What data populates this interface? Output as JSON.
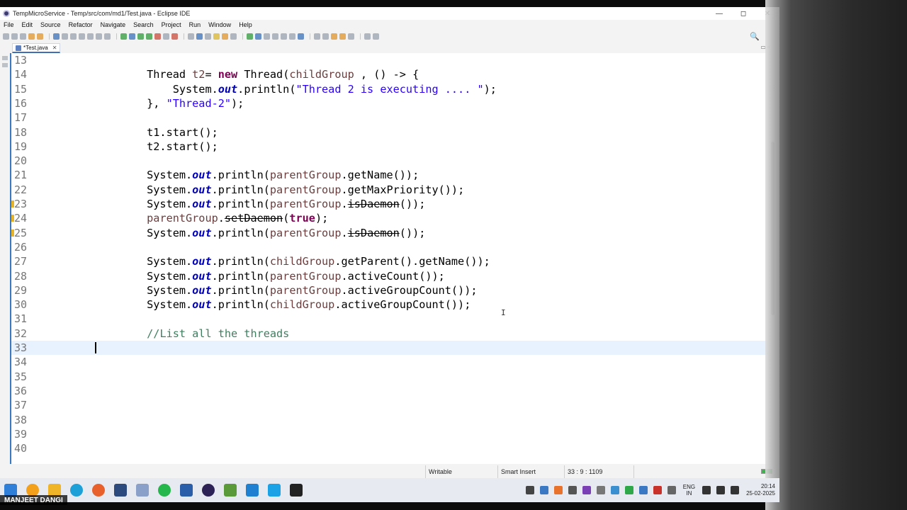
{
  "window": {
    "title": "TempMicroService - Temp/src/com/md1/Test.java - Eclipse IDE",
    "controls": [
      "—",
      "◻",
      "✕"
    ]
  },
  "menu": [
    "File",
    "Edit",
    "Source",
    "Refactor",
    "Navigate",
    "Search",
    "Project",
    "Run",
    "Window",
    "Help"
  ],
  "editor_tab": {
    "label": "*Test.java",
    "close": "✕"
  },
  "min_max": "▭ ▫",
  "code_lines": [
    {
      "n": "13",
      "html": ""
    },
    {
      "n": "14",
      "html": "        Thread <span class=\"var\">t2</span>= <span class=\"kw\">new</span> Thread(<span class=\"var\">childGroup</span> , () -> {"
    },
    {
      "n": "15",
      "html": "            System.<span class=\"fld\">out</span>.println(<span class=\"str\">\"Thread 2 is executing .... \"</span>);"
    },
    {
      "n": "16",
      "html": "        }, <span class=\"str\">\"Thread-2\"</span>);"
    },
    {
      "n": "17",
      "html": ""
    },
    {
      "n": "18",
      "html": "        t1.start();"
    },
    {
      "n": "19",
      "html": "        t2.start();"
    },
    {
      "n": "20",
      "html": ""
    },
    {
      "n": "21",
      "html": "        System.<span class=\"fld\">out</span>.println(<span class=\"var\">parentGroup</span>.getName());"
    },
    {
      "n": "22",
      "html": "        System.<span class=\"fld\">out</span>.println(<span class=\"var\">parentGroup</span>.getMaxPriority());"
    },
    {
      "n": "23",
      "html": "        System.<span class=\"fld\">out</span>.println(<span class=\"var\">parentGroup</span>.<span class=\"dep\">isDaemon</span>());",
      "warn": true
    },
    {
      "n": "24",
      "html": "        <span class=\"var\">parentGroup</span>.<span class=\"dep\">setDaemon</span>(<span class=\"kw\">true</span>);",
      "warn": true
    },
    {
      "n": "25",
      "html": "        System.<span class=\"fld\">out</span>.println(<span class=\"var\">parentGroup</span>.<span class=\"dep\">isDaemon</span>());",
      "warn": true
    },
    {
      "n": "26",
      "html": ""
    },
    {
      "n": "27",
      "html": "        System.<span class=\"fld\">out</span>.println(<span class=\"var\">childGroup</span>.getParent().getName());"
    },
    {
      "n": "28",
      "html": "        System.<span class=\"fld\">out</span>.println(<span class=\"var\">parentGroup</span>.activeCount());"
    },
    {
      "n": "29",
      "html": "        System.<span class=\"fld\">out</span>.println(<span class=\"var\">parentGroup</span>.activeGroupCount());"
    },
    {
      "n": "30",
      "html": "        System.<span class=\"fld\">out</span>.println(<span class=\"var\">childGroup</span>.activeGroupCount());"
    },
    {
      "n": "31",
      "html": ""
    },
    {
      "n": "32",
      "html": "        <span class=\"cmt\">//List all the threads</span>"
    },
    {
      "n": "33",
      "html": "",
      "current": true
    },
    {
      "n": "34",
      "html": ""
    },
    {
      "n": "35",
      "html": ""
    },
    {
      "n": "36",
      "html": ""
    },
    {
      "n": "37",
      "html": ""
    },
    {
      "n": "38",
      "html": ""
    },
    {
      "n": "39",
      "html": ""
    },
    {
      "n": "40",
      "html": ""
    }
  ],
  "status": {
    "writable": "Writable",
    "insert_mode": "Smart Insert",
    "position": "33 : 9 : 1109"
  },
  "tray": {
    "lang_line1": "ENG",
    "lang_line2": "IN",
    "time": "20:14",
    "date": "25-02-2025"
  },
  "watermark": "MANJEET DANGI",
  "colors": {
    "keyword": "#7f0055",
    "field": "#0000c0",
    "string": "#2a00ff",
    "variable": "#6a3e3e",
    "comment": "#3f7f5f",
    "current_line": "#e8f2fe",
    "selection_accent": "#3a78c4"
  }
}
